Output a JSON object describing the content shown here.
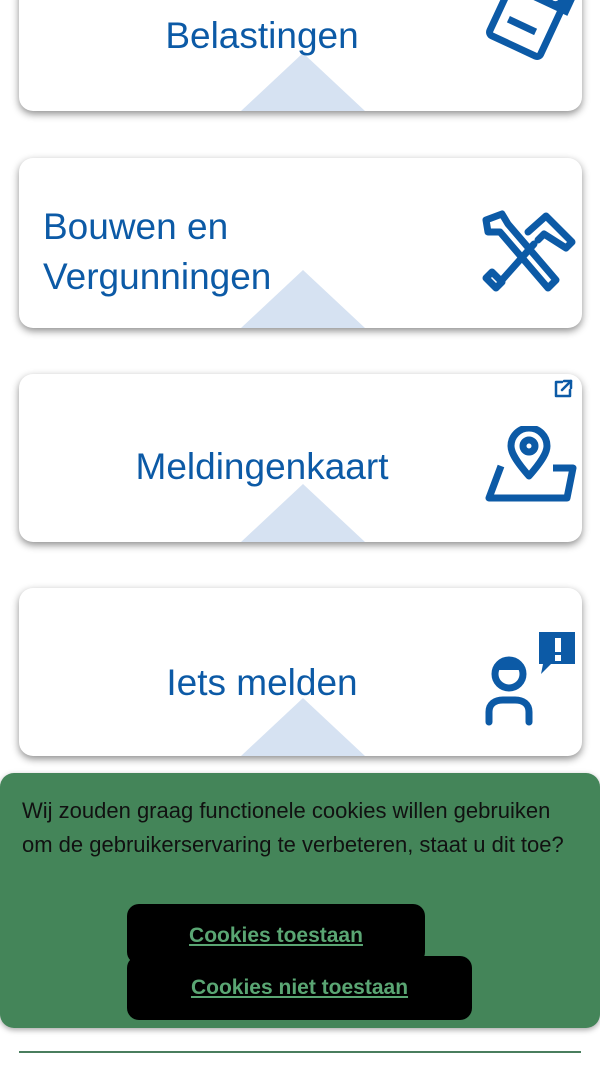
{
  "cards": [
    {
      "label": "Belastingen",
      "icon": "tax-document-euro-icon"
    },
    {
      "label": "Bouwen en Vergunningen",
      "icon": "hammer-wrench-icon"
    },
    {
      "label": "Meldingenkaart",
      "icon": "map-pin-icon",
      "external": true,
      "external_icon": "external-link-icon"
    },
    {
      "label": "Iets melden",
      "icon": "person-report-icon"
    }
  ],
  "cookie_banner": {
    "message": "Wij zouden graag functionele cookies willen gebruiken om de gebruikerservaring te verbeteren, staat u dit toe?",
    "allow_label": "Cookies toestaan",
    "deny_label": "Cookies niet toestaan"
  },
  "colors": {
    "brand_blue": "#0C5AA6",
    "banner_green": "#448559",
    "button_text_green": "#5AA673"
  }
}
